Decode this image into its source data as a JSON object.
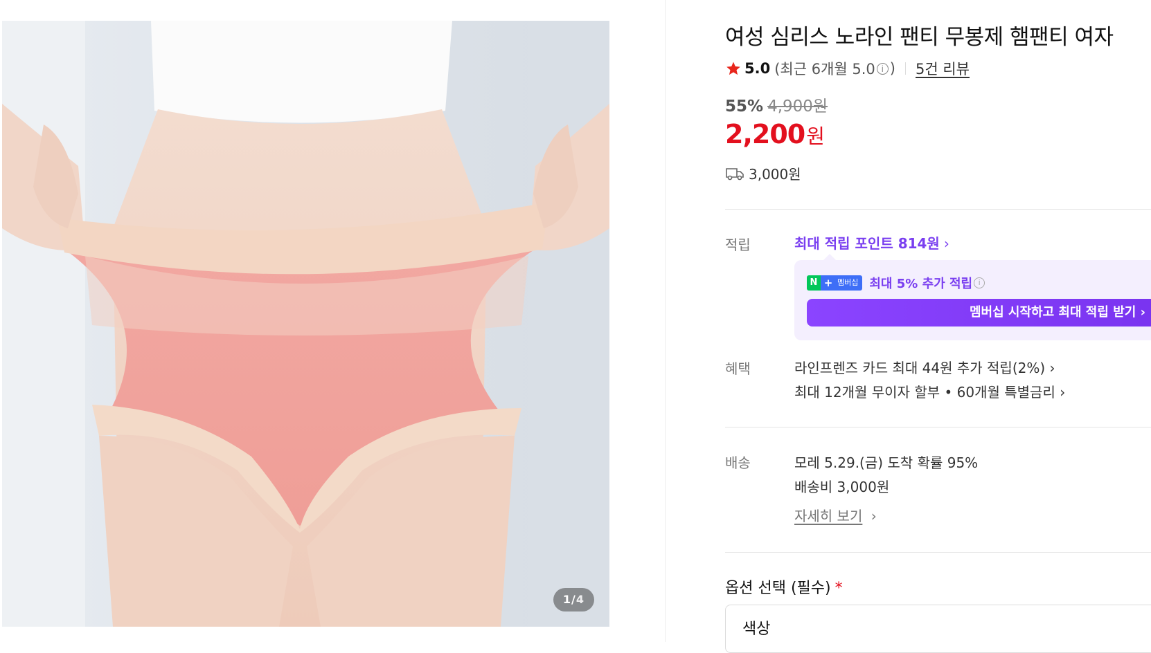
{
  "product": {
    "title": "여성 심리스 노라인 팬티 무봉제 햄팬티 여자",
    "image_counter": {
      "current": "1",
      "slash": "/",
      "total": "4"
    }
  },
  "rating": {
    "score": "5.0",
    "recent_prefix": "(최근 6개월 5.0",
    "recent_suffix": ")",
    "info_glyph": "i",
    "review_link": "5건 리뷰"
  },
  "price": {
    "discount_rate": "55%",
    "original": "4,900원",
    "sale": "2,200",
    "currency": "원",
    "shipping_fee": "3,000원"
  },
  "points": {
    "label": "적립",
    "link": "최대 적립 포인트 814원",
    "chevron": "›",
    "membership_badge": {
      "n": "N",
      "plus": "+",
      "text": "멤버십"
    },
    "membership_text": "최대 5% 추가 적립",
    "membership_button": "멤버십 시작하고 최대 적립 받기 ›"
  },
  "benefits": {
    "label": "혜택",
    "items": [
      "라인프렌즈 카드 최대 44원 추가 적립(2%) ›",
      "최대 12개월 무이자 할부 • 60개월 특별금리 ›"
    ]
  },
  "delivery": {
    "label": "배송",
    "arrival": "모레 5.29.(금) 도착 확률 95%",
    "fee": "배송비 3,000원",
    "detail_link": "자세히 보기",
    "detail_chevron": "›"
  },
  "options": {
    "title": "옵션 선택 (필수)",
    "required_mark": "*",
    "first_select": "색상"
  },
  "colors": {
    "accent_purple": "#7a3ff0",
    "sale_red": "#e3101e",
    "star_red": "#e8261c",
    "naver_green": "#03c75a",
    "naver_blue": "#3e6ef7"
  },
  "icons": [
    "star-icon",
    "info-icon",
    "truck-icon",
    "chevron-right-icon"
  ]
}
